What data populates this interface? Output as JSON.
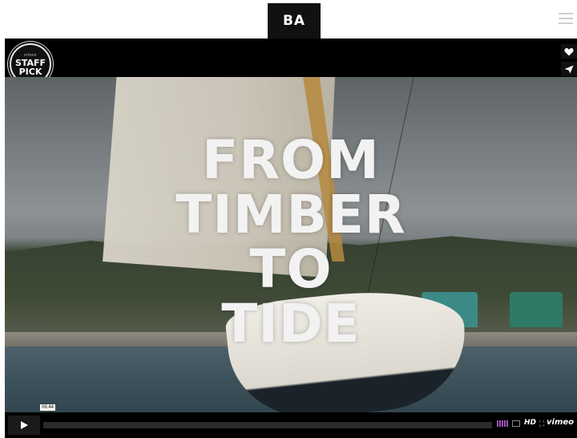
{
  "header": {
    "logo_text": "BA",
    "menu_icon": "hamburger-menu-icon"
  },
  "player": {
    "badge": {
      "brand": "vimeo",
      "line1": "STAFF",
      "line2": "PICK"
    },
    "title_lines": [
      "FROM",
      "TIMBER",
      "TO",
      "TIDE"
    ],
    "side_buttons": {
      "like_icon": "heart-icon",
      "share_icon": "paper-plane-icon"
    },
    "controls": {
      "play_icon": "play-icon",
      "time": "06:44",
      "progress_fraction": 0.0,
      "hd_label": "HD",
      "logo": "vimeo",
      "volume_color": "#9b59b6"
    }
  }
}
